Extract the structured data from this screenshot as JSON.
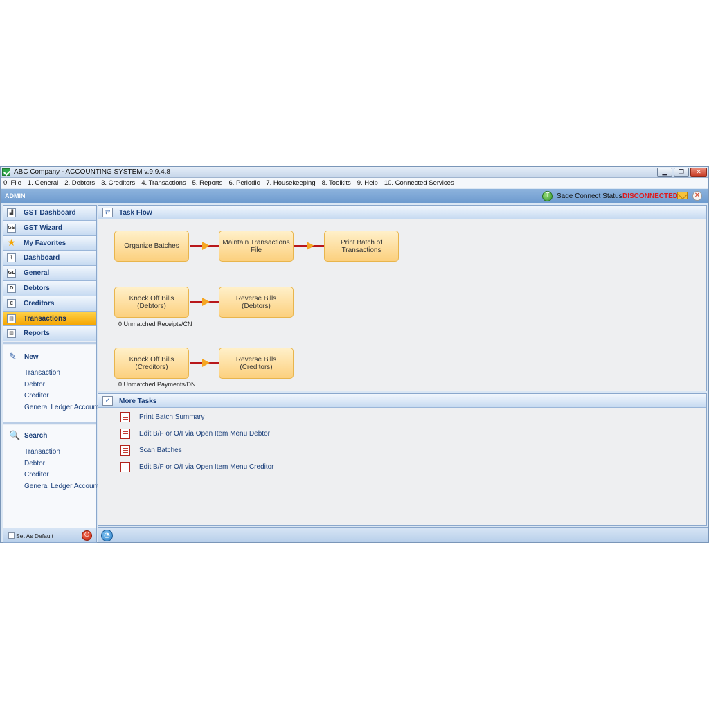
{
  "window": {
    "title": "ABC Company - ACCOUNTING SYSTEM v.9.9.4.8",
    "minimize_glyph": "▁",
    "restore_glyph": "❐",
    "close_glyph": "✕"
  },
  "menu": [
    "0. File",
    "1. General",
    "2. Debtors",
    "3. Creditors",
    "4. Transactions",
    "5. Reports",
    "6. Periodic",
    "7. Housekeeping",
    "8. Toolkits",
    "9. Help",
    "10. Connected Services"
  ],
  "adminbar": {
    "user": "ADMIN",
    "sage_label": "Sage Connect Status :",
    "sage_status": "DISCONNECTED",
    "status_color": "#e0191b"
  },
  "sidebar": {
    "nav": [
      {
        "label": "GST Dashboard",
        "icon": "gst-dashboard-icon",
        "glyph": "▟"
      },
      {
        "label": "GST Wizard",
        "icon": "gst-wizard-icon",
        "glyph": "GST"
      },
      {
        "label": "My Favorites",
        "icon": "star-icon",
        "glyph": "★"
      },
      {
        "label": "Dashboard",
        "icon": "dashboard-chart-icon",
        "glyph": "⌇"
      },
      {
        "label": "General",
        "icon": "general-ledger-icon",
        "glyph": "GL"
      },
      {
        "label": "Debtors",
        "icon": "debtors-icon",
        "glyph": "D"
      },
      {
        "label": "Creditors",
        "icon": "creditors-icon",
        "glyph": "C"
      },
      {
        "label": "Transactions",
        "icon": "transactions-icon",
        "glyph": "▤",
        "active": true
      },
      {
        "label": "Reports",
        "icon": "reports-icon",
        "glyph": "▥"
      }
    ],
    "new_panel": {
      "title": "New",
      "icon_glyph": "✎",
      "links": [
        "Transaction",
        "Debtor",
        "Creditor",
        "General Ledger Account"
      ]
    },
    "search_panel": {
      "title": "Search",
      "icon_glyph": "🔍",
      "links": [
        "Transaction",
        "Debtor",
        "Creditor",
        "General Ledger Account"
      ]
    },
    "footer": {
      "set_default_label": "Set As Default",
      "set_default_checked": false,
      "power_glyph": "⏻"
    }
  },
  "task_flow": {
    "title": "Task Flow",
    "icon_glyph": "⇄",
    "rows": [
      {
        "boxes": [
          "Organize Batches",
          "Maintain Transactions File",
          "Print Batch of Transactions"
        ],
        "note": ""
      },
      {
        "boxes": [
          "Knock Off Bills (Debtors)",
          "Reverse Bills (Debtors)"
        ],
        "note": "0 Unmatched Receipts/CN"
      },
      {
        "boxes": [
          "Knock Off Bills (Creditors)",
          "Reverse Bills (Creditors)"
        ],
        "note": "0 Unmatched Payments/DN"
      }
    ]
  },
  "more_tasks": {
    "title": "More Tasks",
    "icon_glyph": "✓",
    "items": [
      "Print Batch Summary",
      "Edit B/F or O/I via Open Item Menu Debtor",
      "Scan Batches",
      "Edit B/F or O/I via Open Item Menu Creditor"
    ]
  },
  "statusbar": {
    "rss_glyph": "◔"
  }
}
